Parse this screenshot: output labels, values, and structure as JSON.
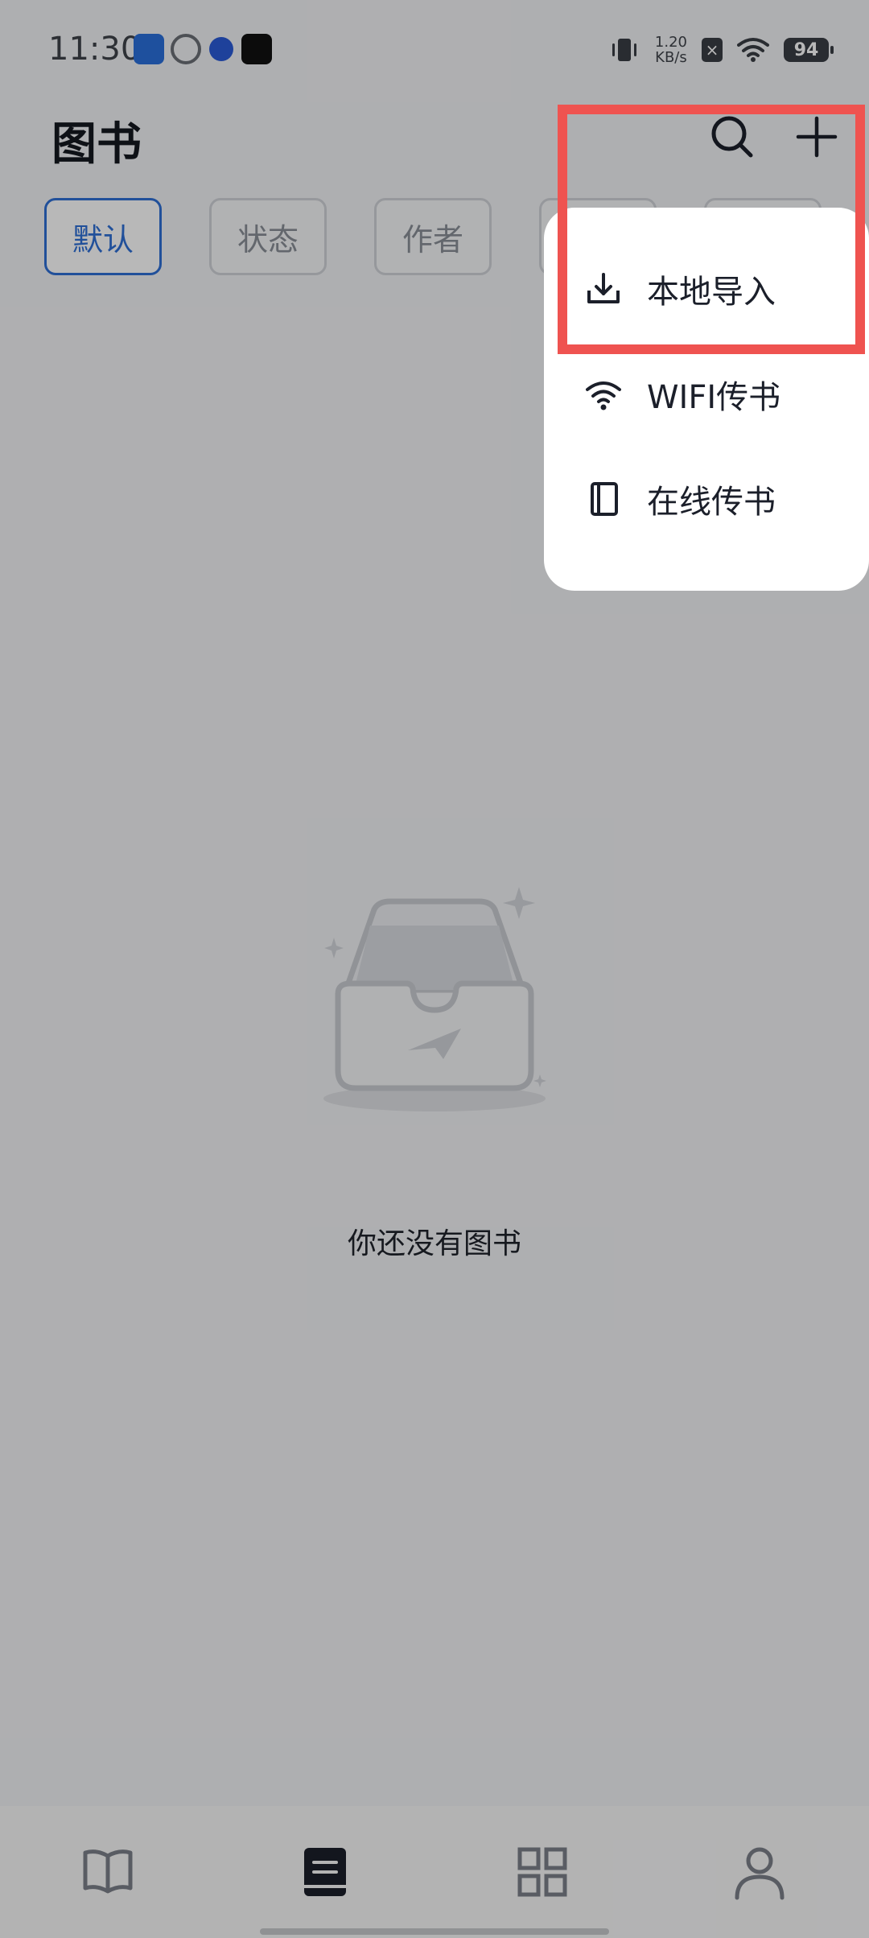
{
  "status_bar": {
    "time": "11:30",
    "net_speed_value": "1.20",
    "net_speed_unit": "KB/s",
    "battery": "94",
    "icons": [
      "vibrate-icon",
      "wifi-icon",
      "close-badge-icon",
      "battery-icon"
    ]
  },
  "header": {
    "title": "图书",
    "icons": [
      "search-icon",
      "plus-icon"
    ]
  },
  "filter_tabs": [
    {
      "label": "默认",
      "active": true
    },
    {
      "label": "状态",
      "active": false
    },
    {
      "label": "作者",
      "active": false
    },
    {
      "label": "",
      "active": false
    },
    {
      "label": "",
      "active": false
    }
  ],
  "empty_state": {
    "message": "你还没有图书",
    "icon": "empty-inbox-icon"
  },
  "menu": {
    "items": [
      {
        "label": "本地导入",
        "icon": "download-icon"
      },
      {
        "label": "WIFI传书",
        "icon": "wifi-icon"
      },
      {
        "label": "在线传书",
        "icon": "book-icon"
      }
    ]
  },
  "bottom_nav": {
    "items": [
      {
        "name": "reading",
        "icon": "open-book-icon"
      },
      {
        "name": "bookshelf",
        "icon": "bookshelf-icon",
        "active": true
      },
      {
        "name": "discover",
        "icon": "grid-icon"
      },
      {
        "name": "profile",
        "icon": "person-icon"
      }
    ]
  },
  "colors": {
    "accent": "#2f6fd6",
    "highlight": "#ef5350"
  }
}
